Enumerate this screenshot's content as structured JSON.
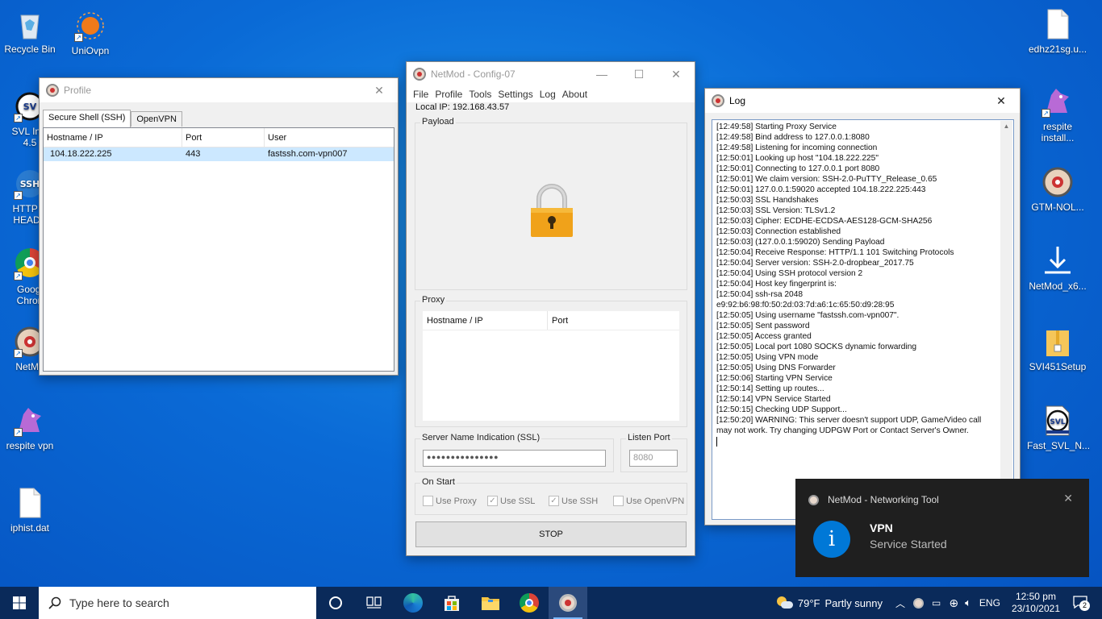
{
  "desktop": {
    "icons_left": [
      {
        "label": "Recycle Bin",
        "icon": "recycle-bin-icon"
      },
      {
        "label": "UniOvpn",
        "icon": "unio-vpn-icon"
      },
      {
        "label": "SVL Inje\n4.5",
        "icon": "svl-injector-icon"
      },
      {
        "label": "HTTP N\nHEADE",
        "icon": "ssh-icon"
      },
      {
        "label": "Googl\nChron",
        "icon": "chrome-icon"
      },
      {
        "label": "NetMo",
        "icon": "netmod-icon"
      },
      {
        "label": "respite vpn",
        "icon": "respite-icon"
      },
      {
        "label": "iphist.dat",
        "icon": "file-icon"
      }
    ],
    "icons_right": [
      {
        "label": "edhz21sg.u...",
        "icon": "file-icon"
      },
      {
        "label": "respite\ninstall...",
        "icon": "respite-icon"
      },
      {
        "label": "GTM-NOL...",
        "icon": "gear-icon"
      },
      {
        "label": "NetMod_x6...",
        "icon": "download-icon"
      },
      {
        "label": "SVI451Setup",
        "icon": "zip-icon"
      },
      {
        "label": "Fast_SVL_N...",
        "icon": "svl-icon"
      }
    ]
  },
  "profile_window": {
    "title": "Profile",
    "tabs": [
      "Secure Shell (SSH)",
      "OpenVPN"
    ],
    "columns": [
      "Hostname / IP",
      "Port",
      "User"
    ],
    "rows": [
      {
        "host": "104.18.222.225",
        "port": "443",
        "user": "fastssh.com-vpn007"
      }
    ]
  },
  "main_window": {
    "title": "NetMod - Config-07",
    "menu": [
      "File",
      "Profile",
      "Tools",
      "Settings",
      "Log",
      "About"
    ],
    "local_ip_label": "Local IP:",
    "local_ip": "192.168.43.57",
    "payload_label": "Payload",
    "proxy_label": "Proxy",
    "proxy_columns": [
      "Hostname / IP",
      "Port"
    ],
    "sni_label": "Server Name Indication (SSL)",
    "sni_value": "●●●●●●●●●●●●●●●",
    "listen_port_label": "Listen Port",
    "listen_port": "8080",
    "on_start_label": "On Start",
    "options": [
      {
        "label": "Use Proxy",
        "checked": false
      },
      {
        "label": "Use SSL",
        "checked": true
      },
      {
        "label": "Use SSH",
        "checked": true
      },
      {
        "label": "Use OpenVPN",
        "checked": false
      }
    ],
    "stop_label": "STOP"
  },
  "log_window": {
    "title": "Log",
    "lines": [
      "[12:49:58] Starting Proxy Service",
      "[12:49:58] Bind address to 127.0.0.1:8080",
      "[12:49:58] Listening for incoming connection",
      "[12:50:01] Looking up host \"104.18.222.225\"",
      "[12:50:01] Connecting to 127.0.0.1 port 8080",
      "[12:50:01] We claim version: SSH-2.0-PuTTY_Release_0.65",
      "[12:50:01] 127.0.0.1:59020 accepted 104.18.222.225:443",
      "[12:50:03] SSL Handshakes",
      "[12:50:03] SSL Version: TLSv1.2",
      "[12:50:03] Cipher: ECDHE-ECDSA-AES128-GCM-SHA256",
      "[12:50:03] Connection established",
      "[12:50:03] (127.0.0.1:59020) Sending Payload",
      "[12:50:04] Receive Response: HTTP/1.1 101 Switching Protocols",
      "[12:50:04] Server version: SSH-2.0-dropbear_2017.75",
      "[12:50:04] Using SSH protocol version 2",
      "[12:50:04] Host key fingerprint is:",
      "[12:50:04] ssh-rsa 2048",
      "e9:92:b6:98:f0:50:2d:03:7d:a6:1c:65:50:d9:28:95",
      "[12:50:05] Using username \"fastssh.com-vpn007\".",
      "[12:50:05] Sent password",
      "[12:50:05] Access granted",
      "[12:50:05] Local port 1080 SOCKS dynamic forwarding",
      "[12:50:05] Using VPN mode",
      "[12:50:05] Using DNS Forwarder",
      "[12:50:06] Starting VPN Service",
      "[12:50:14] Setting up routes...",
      "[12:50:14] VPN Service Started",
      "[12:50:15] Checking UDP Support...",
      "[12:50:20] WARNING: This server doesn't support UDP, Game/Video call may not work. Try changing UDPGW Port or Contact Server's Owner."
    ]
  },
  "notification": {
    "app_name": "NetMod - Networking Tool",
    "title": "VPN",
    "message": "Service Started",
    "icon_glyph": "i"
  },
  "taskbar": {
    "search_placeholder": "Type here to search",
    "weather_temp": "79°F",
    "weather_text": "Partly sunny",
    "language": "ENG",
    "time": "12:50 pm",
    "date": "23/10/2021",
    "notification_count": "2"
  },
  "colors": {
    "desktop": "#0a6ad6",
    "taskbar": "#0a2a5a",
    "selection": "#cce8ff",
    "toast_bg": "#1f1f1f",
    "info_blue": "#0078d7"
  }
}
